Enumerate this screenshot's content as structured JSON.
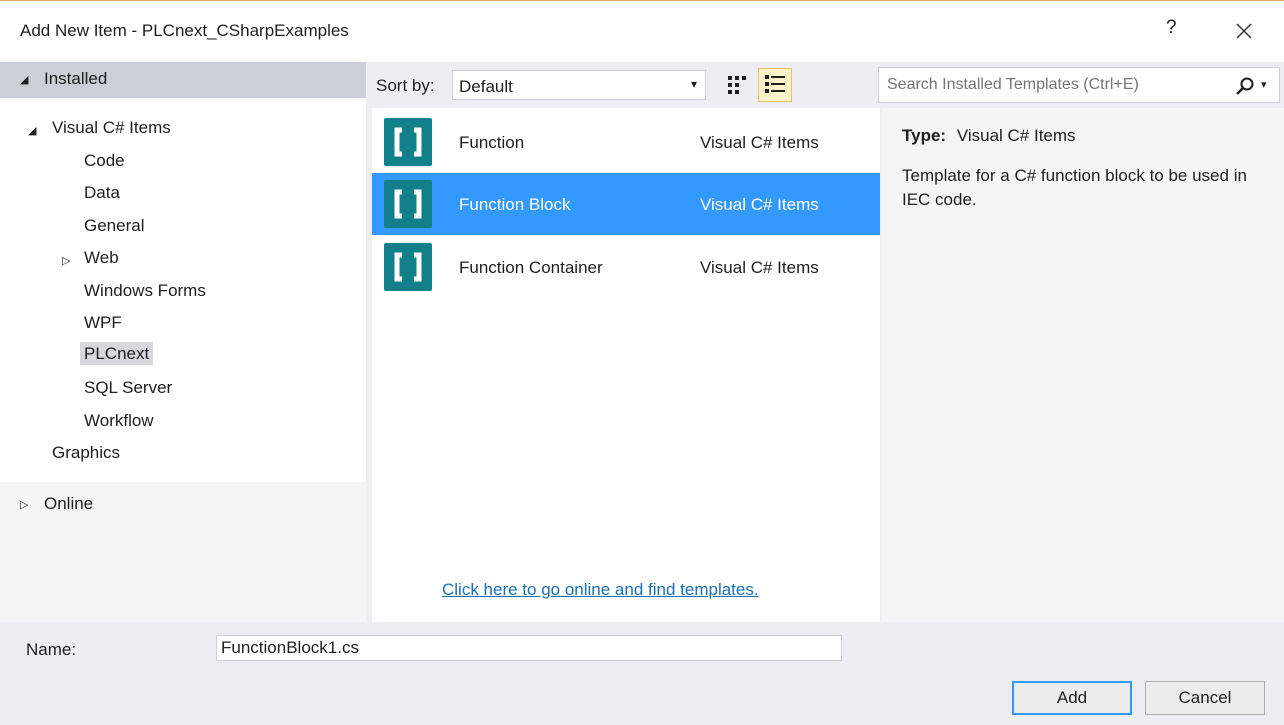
{
  "window": {
    "title": "Add New Item - PLCnext_CSharpExamples",
    "help_label": "?"
  },
  "left_pane": {
    "installed_label": "Installed",
    "tree": [
      {
        "label": "Visual C# Items",
        "expanded": true
      },
      {
        "label": "Code"
      },
      {
        "label": "Data"
      },
      {
        "label": "General"
      },
      {
        "label": "Web",
        "collapsed": true
      },
      {
        "label": "Windows Forms"
      },
      {
        "label": "WPF"
      },
      {
        "label": "PLCnext",
        "selected": true
      },
      {
        "label": "SQL Server"
      },
      {
        "label": "Workflow"
      },
      {
        "label": "Graphics"
      }
    ],
    "online_label": "Online"
  },
  "toolbar": {
    "sort_label": "Sort by:",
    "sort_value": "Default"
  },
  "search": {
    "placeholder": "Search Installed Templates (Ctrl+E)"
  },
  "templates": [
    {
      "name": "Function",
      "category": "Visual C# Items"
    },
    {
      "name": "Function Block",
      "category": "Visual C# Items",
      "selected": true
    },
    {
      "name": "Function Container",
      "category": "Visual C# Items"
    }
  ],
  "online_link": "Click here to go online and find templates.",
  "details": {
    "type_key": "Type:",
    "type_value": "Visual C# Items",
    "description": "Template for a C# function block to be used in IEC code."
  },
  "name_field": {
    "label": "Name:",
    "value": "FunctionBlock1.cs"
  },
  "buttons": {
    "add": "Add",
    "cancel": "Cancel"
  },
  "colors": {
    "selection": "#3399ff",
    "icon_teal": "#12808a",
    "link": "#1a6fb8"
  }
}
